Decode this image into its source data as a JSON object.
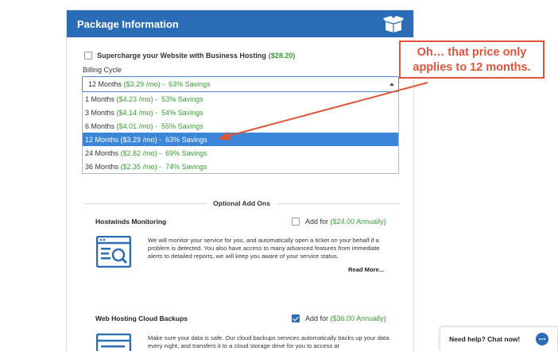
{
  "panel": {
    "title": "Package Information",
    "supercharge": {
      "label": "Supercharge your Website with Business Hosting",
      "price": "($28.20)"
    },
    "billing": {
      "label": "Billing Cycle",
      "selected_term": "12 Months",
      "selected_price": "($3.29 /mo)",
      "selected_savings": " -  63% Savings",
      "options": [
        {
          "term": "1 Months",
          "price": "($4.23 /mo)",
          "savings": " -  53% Savings",
          "selected": false
        },
        {
          "term": "3 Months",
          "price": "($4.14 /mo)",
          "savings": " -  54% Savings",
          "selected": false
        },
        {
          "term": "6 Months",
          "price": "($4.01 /mo)",
          "savings": " -  55% Savings",
          "selected": false
        },
        {
          "term": "12 Months",
          "price": "($3.29 /mo)",
          "savings": " -  63% Savings",
          "selected": true
        },
        {
          "term": "24 Months",
          "price": "($2.82 /mo)",
          "savings": " -  69% Savings",
          "selected": false
        },
        {
          "term": "36 Months",
          "price": "($2.35 /mo)",
          "savings": " -  74% Savings",
          "selected": false
        }
      ]
    },
    "addons_heading": "Optional Add Ons",
    "addons": [
      {
        "title": "Hostwinds Monitoring",
        "checked": false,
        "add_label": "Add for",
        "add_price": "($24.00 Annually)",
        "icon": "monitor-search-icon",
        "description": "We will monitor your service for you, and automatically open a ticket on your behalf if a problem is detected. You also have access to many advanced features from immediate alerts to detailed reports, we will keep you aware of your service status.",
        "read_more": "Read More..."
      },
      {
        "title": "Web Hosting Cloud Backups",
        "checked": true,
        "add_label": "Add for",
        "add_price": "($36.00 Annually)",
        "icon": "backup-icon",
        "description": "Make sure your data is safe. Our cloud backups services automatically backs up your data every night, and transfers it to a cloud storage drive for you to access at"
      }
    ]
  },
  "callout": {
    "line1": "Oh… that price only",
    "line2": "applies to 12 months."
  },
  "chat": {
    "label": "Need help? Chat now!"
  },
  "colors": {
    "header_blue": "#2a6db6",
    "price_green": "#3a9a35",
    "selected_blue": "#3b86d8",
    "callout_red": "#e0553a"
  }
}
